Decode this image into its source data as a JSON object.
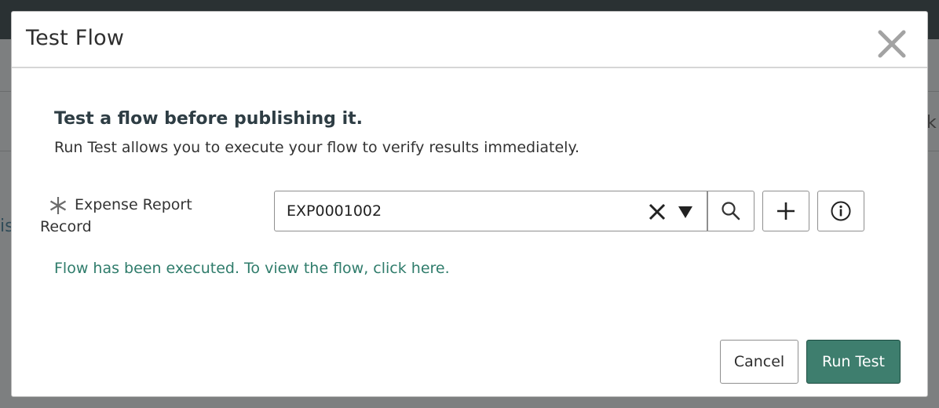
{
  "background": {
    "left_fragment": "is",
    "right_fragment": "k"
  },
  "dialog": {
    "title": "Test Flow",
    "close_icon": "close-icon",
    "intro_title": "Test a flow before publishing it.",
    "intro_description": "Run Test allows you to execute your flow to verify results immediately.",
    "field": {
      "required_icon": "asterisk-icon",
      "label": "Expense Report Record",
      "value": "EXP0001002",
      "clear_icon": "clear-icon",
      "dropdown_icon": "caret-down-icon",
      "search_icon": "search-icon",
      "add_icon": "plus-icon",
      "info_icon": "info-icon"
    },
    "status_link": "Flow has been executed. To view the flow, click here.",
    "buttons": {
      "cancel": "Cancel",
      "run_test": "Run Test"
    }
  },
  "colors": {
    "accent": "#3e7e6e",
    "link": "#2f7c6b",
    "top_bar": "#2a3133",
    "overlay": "#7d7f80"
  }
}
